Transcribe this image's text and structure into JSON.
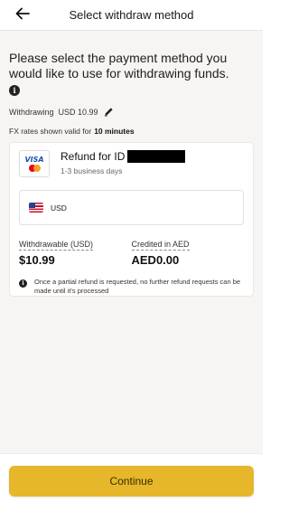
{
  "header": {
    "title": "Select withdraw method",
    "back_icon": "arrow-left-icon"
  },
  "intro": "Please select the payment method you would like to use for withdrawing funds.",
  "withdrawing": {
    "label": "Withdrawing",
    "amount": "USD 10.99",
    "edit_icon": "pencil-icon"
  },
  "fx": {
    "label": "FX rates shown valid for",
    "duration": "10 minutes"
  },
  "card": {
    "brand_visa": "VISA",
    "title": "Refund for ID",
    "subtitle": "1-3 business days",
    "currency": "USD",
    "withdrawable_label": "Withdrawable (USD)",
    "withdrawable_value": "$10.99",
    "credited_label": "Credited in AED",
    "credited_value": "AED0.00",
    "note": "Once a partial refund is requested, no further refund requests can be made until it's processed"
  },
  "footer": {
    "continue_label": "Continue"
  },
  "colors": {
    "accent": "#e6b72a",
    "background": "#f7f5f3"
  }
}
